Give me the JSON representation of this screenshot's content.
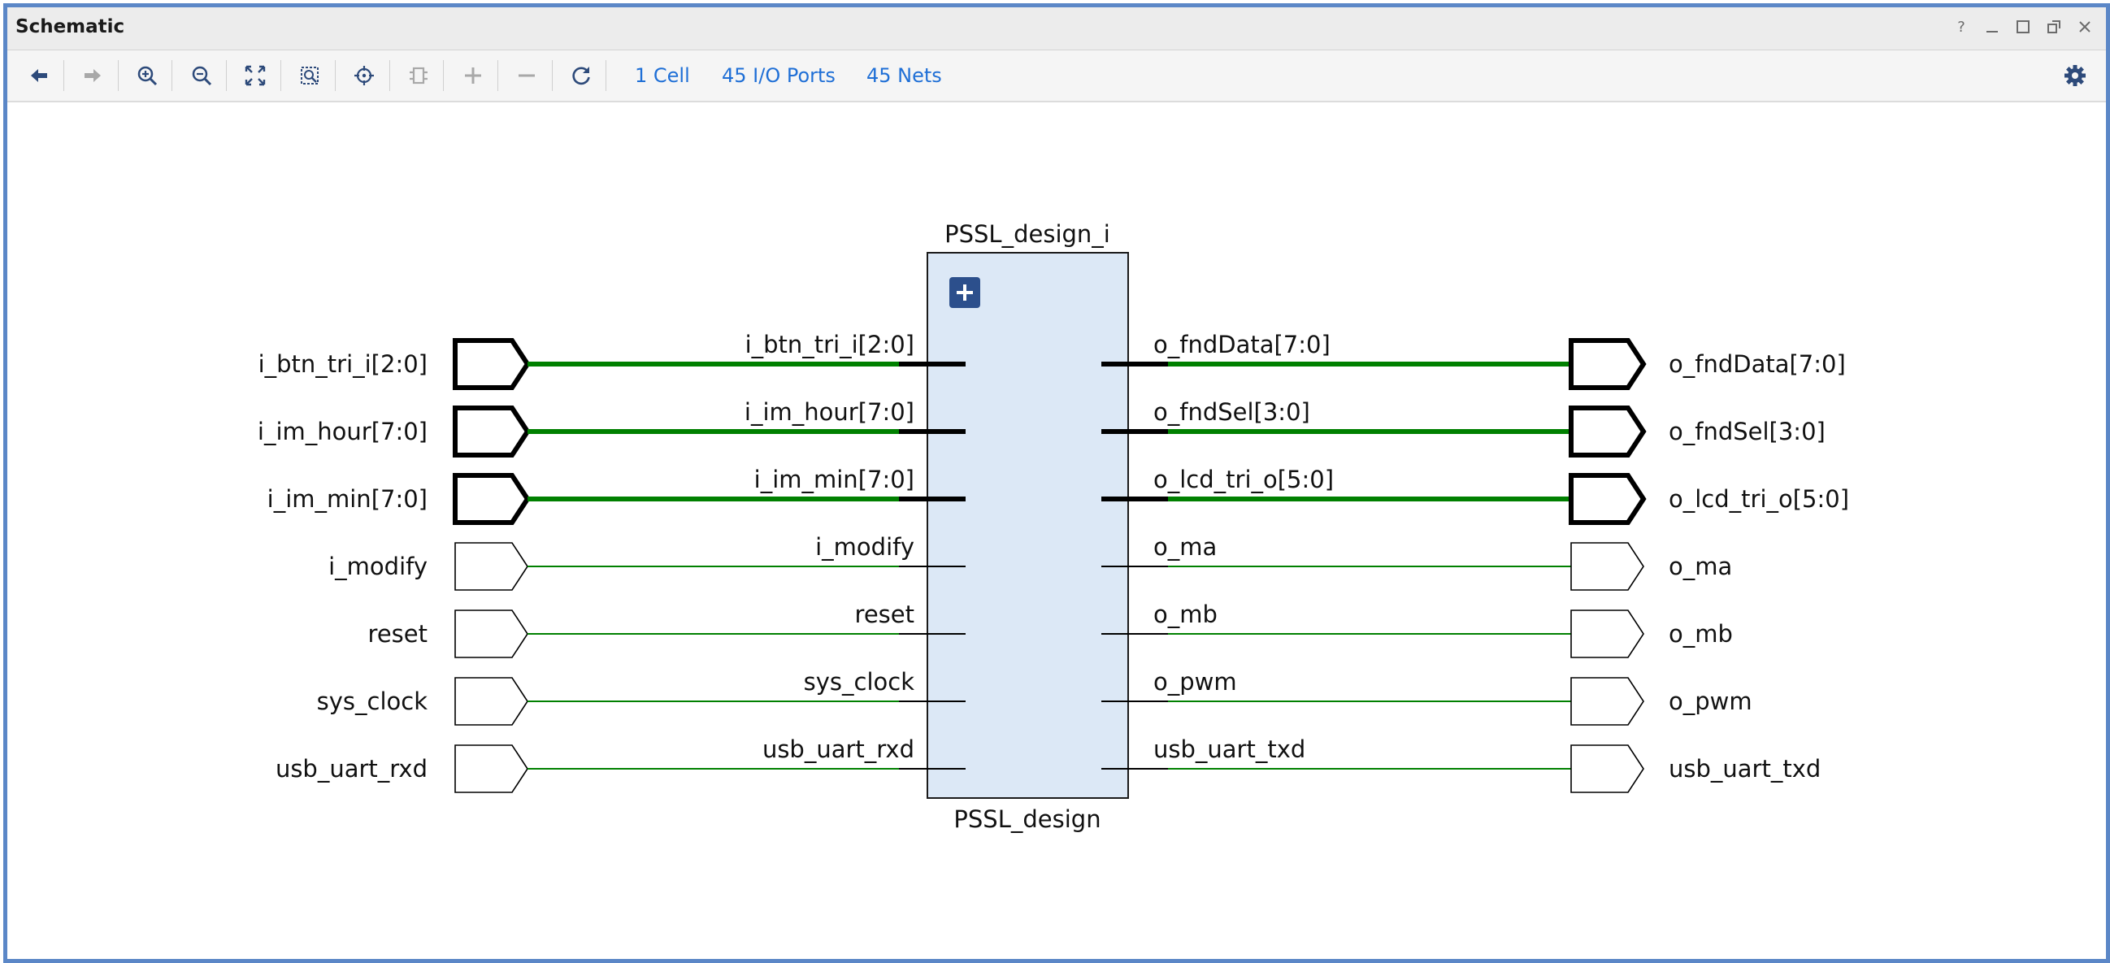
{
  "window": {
    "title": "Schematic"
  },
  "toolbar": {
    "cell_count": "1 Cell",
    "io_ports": "45 I/O Ports",
    "nets": "45 Nets"
  },
  "schematic": {
    "instance_name": "PSSL_design_i",
    "cell_type": "PSSL_design",
    "inputs": [
      {
        "port": "i_btn_tri_i[2:0]",
        "pin": "i_btn_tri_i[2:0]",
        "bus": true
      },
      {
        "port": "i_im_hour[7:0]",
        "pin": "i_im_hour[7:0]",
        "bus": true
      },
      {
        "port": "i_im_min[7:0]",
        "pin": "i_im_min[7:0]",
        "bus": true
      },
      {
        "port": "i_modify",
        "pin": "i_modify",
        "bus": false
      },
      {
        "port": "reset",
        "pin": "reset",
        "bus": false
      },
      {
        "port": "sys_clock",
        "pin": "sys_clock",
        "bus": false
      },
      {
        "port": "usb_uart_rxd",
        "pin": "usb_uart_rxd",
        "bus": false
      }
    ],
    "outputs": [
      {
        "port": "o_fndData[7:0]",
        "pin": "o_fndData[7:0]",
        "bus": true
      },
      {
        "port": "o_fndSel[3:0]",
        "pin": "o_fndSel[3:0]",
        "bus": true
      },
      {
        "port": "o_lcd_tri_o[5:0]",
        "pin": "o_lcd_tri_o[5:0]",
        "bus": true
      },
      {
        "port": "o_ma",
        "pin": "o_ma",
        "bus": false
      },
      {
        "port": "o_mb",
        "pin": "o_mb",
        "bus": false
      },
      {
        "port": "o_pwm",
        "pin": "o_pwm",
        "bus": false
      },
      {
        "port": "usb_uart_txd",
        "pin": "usb_uart_txd",
        "bus": false
      }
    ]
  },
  "colors": {
    "net": "#008000",
    "cell_fill": "#dce8f6",
    "window_border": "#5b87c7",
    "link": "#1f6fd6",
    "expand_button": "#2c4f8c"
  },
  "icons": {
    "window": [
      "help-icon",
      "minimize-icon",
      "maximize-icon",
      "restore-icon",
      "close-icon"
    ],
    "toolbar": [
      "back-icon",
      "forward-icon",
      "zoom-in-icon",
      "zoom-out-icon",
      "zoom-fit-icon",
      "zoom-area-icon",
      "center-icon",
      "cell-icon",
      "expand-icon",
      "collapse-icon",
      "refresh-icon",
      "settings-icon"
    ]
  }
}
